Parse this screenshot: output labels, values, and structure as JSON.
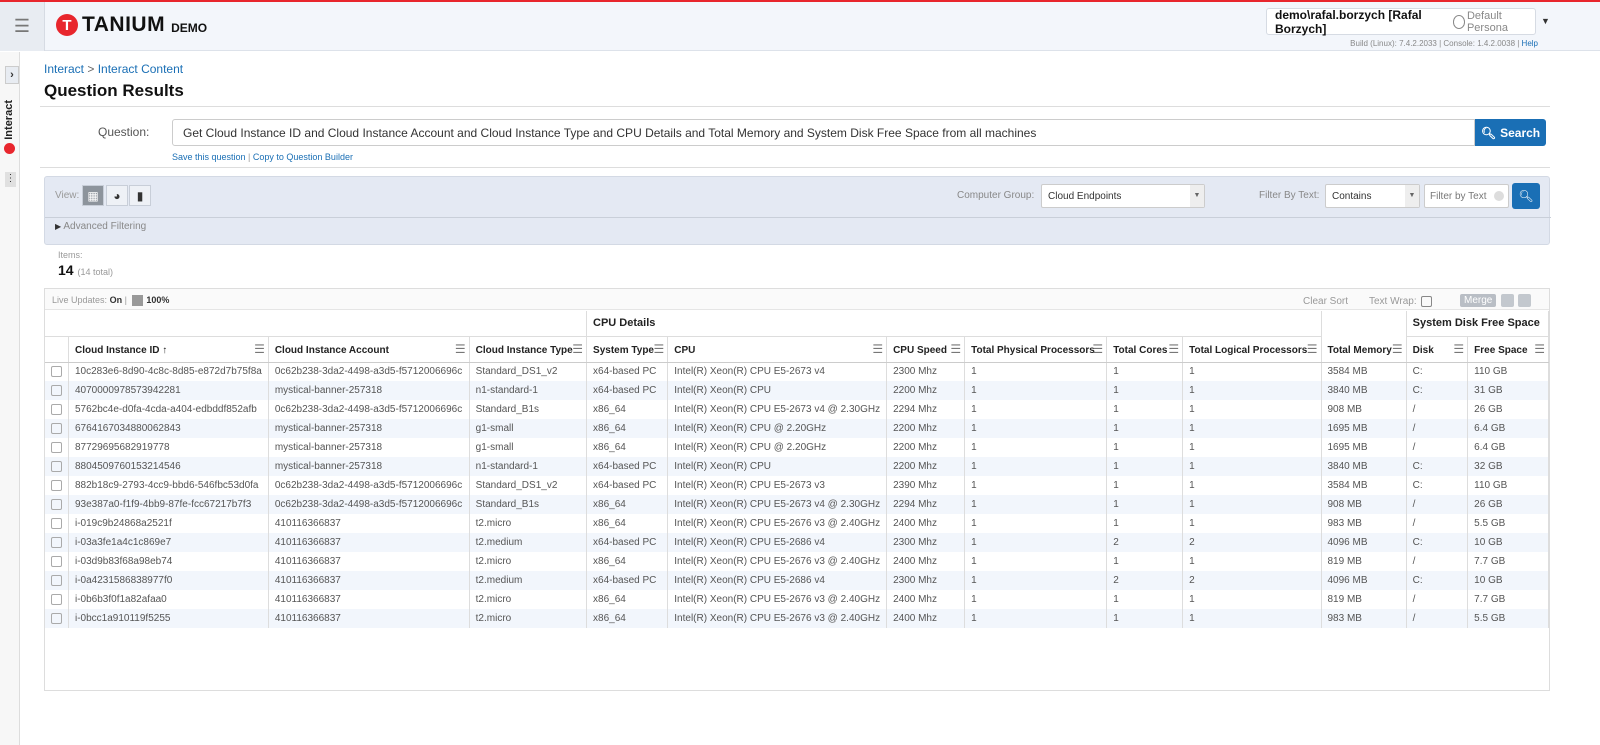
{
  "header": {
    "brand": "TANIUM",
    "brand_suffix": "DEMO",
    "user": "demo\\rafal.borzych [Rafal Borzych]",
    "persona": "Default Persona",
    "build": "Build (Linux): 7.4.2.2033 | Console: 1.4.2.0038 | ",
    "help": "Help"
  },
  "sidebar": {
    "label": "Interact"
  },
  "breadcrumb": {
    "root": "Interact",
    "sep": " > ",
    "current": "Interact Content"
  },
  "page_title": "Question Results",
  "question": {
    "label": "Question:",
    "value": "Get Cloud Instance ID and Cloud Instance Account and Cloud Instance Type and CPU Details and Total Memory and System Disk Free Space from all machines",
    "search": "Search",
    "save": "Save this question",
    "copy": "Copy to Question Builder"
  },
  "filters": {
    "view_label": "View:",
    "advanced": "Advanced Filtering",
    "computer_group_label": "Computer Group:",
    "computer_group": "Cloud Endpoints",
    "filter_label": "Filter By Text:",
    "filter_mode": "Contains",
    "filter_placeholder": "Filter by Text"
  },
  "items": {
    "label": "Items:",
    "count": "14",
    "total": "(14 total)"
  },
  "grid_toolbar": {
    "live_label": "Live Updates:",
    "live_value": "On",
    "progress": "100%",
    "clear_sort": "Clear Sort",
    "text_wrap": "Text Wrap:",
    "merge": "Merge"
  },
  "groups": {
    "cpu": "CPU Details",
    "disk": "System Disk Free Space"
  },
  "columns": [
    "Cloud Instance ID ↑",
    "Cloud Instance Account",
    "Cloud Instance Type",
    "System Type",
    "CPU",
    "CPU Speed",
    "Total Physical Processors",
    "Total Cores",
    "Total Logical Processors",
    "Total Memory",
    "Disk",
    "Free Space"
  ],
  "rows": [
    [
      "10c283e6-8d90-4c8c-8d85-e872d7b75f8a",
      "0c62b238-3da2-4498-a3d5-f5712006696c",
      "Standard_DS1_v2",
      "x64-based PC",
      "Intel(R) Xeon(R) CPU E5-2673 v4",
      "2300 Mhz",
      "1",
      "1",
      "1",
      "3584 MB",
      "C:",
      "110 GB"
    ],
    [
      "4070000978573942281",
      "mystical-banner-257318",
      "n1-standard-1",
      "x64-based PC",
      "Intel(R) Xeon(R) CPU",
      "2200 Mhz",
      "1",
      "1",
      "1",
      "3840 MB",
      "C:",
      "31 GB"
    ],
    [
      "5762bc4e-d0fa-4cda-a404-edbddf852afb",
      "0c62b238-3da2-4498-a3d5-f5712006696c",
      "Standard_B1s",
      "x86_64",
      "Intel(R) Xeon(R) CPU E5-2673 v4 @ 2.30GHz",
      "2294 Mhz",
      "1",
      "1",
      "1",
      "908 MB",
      "/",
      "26 GB"
    ],
    [
      "6764167034880062843",
      "mystical-banner-257318",
      "g1-small",
      "x86_64",
      "Intel(R) Xeon(R) CPU @ 2.20GHz",
      "2200 Mhz",
      "1",
      "1",
      "1",
      "1695 MB",
      "/",
      "6.4 GB"
    ],
    [
      "87729695682919778",
      "mystical-banner-257318",
      "g1-small",
      "x86_64",
      "Intel(R) Xeon(R) CPU @ 2.20GHz",
      "2200 Mhz",
      "1",
      "1",
      "1",
      "1695 MB",
      "/",
      "6.4 GB"
    ],
    [
      "8804509760153214546",
      "mystical-banner-257318",
      "n1-standard-1",
      "x64-based PC",
      "Intel(R) Xeon(R) CPU",
      "2200 Mhz",
      "1",
      "1",
      "1",
      "3840 MB",
      "C:",
      "32 GB"
    ],
    [
      "882b18c9-2793-4cc9-bbd6-546fbc53d0fa",
      "0c62b238-3da2-4498-a3d5-f5712006696c",
      "Standard_DS1_v2",
      "x64-based PC",
      "Intel(R) Xeon(R) CPU E5-2673 v3",
      "2390 Mhz",
      "1",
      "1",
      "1",
      "3584 MB",
      "C:",
      "110 GB"
    ],
    [
      "93e387a0-f1f9-4bb9-87fe-fcc67217b7f3",
      "0c62b238-3da2-4498-a3d5-f5712006696c",
      "Standard_B1s",
      "x86_64",
      "Intel(R) Xeon(R) CPU E5-2673 v4 @ 2.30GHz",
      "2294 Mhz",
      "1",
      "1",
      "1",
      "908 MB",
      "/",
      "26 GB"
    ],
    [
      "i-019c9b24868a2521f",
      "410116366837",
      "t2.micro",
      "x86_64",
      "Intel(R) Xeon(R) CPU E5-2676 v3 @ 2.40GHz",
      "2400 Mhz",
      "1",
      "1",
      "1",
      "983 MB",
      "/",
      "5.5 GB"
    ],
    [
      "i-03a3fe1a4c1c869e7",
      "410116366837",
      "t2.medium",
      "x64-based PC",
      "Intel(R) Xeon(R) CPU E5-2686 v4",
      "2300 Mhz",
      "1",
      "2",
      "2",
      "4096 MB",
      "C:",
      "10 GB"
    ],
    [
      "i-03d9b83f68a98eb74",
      "410116366837",
      "t2.micro",
      "x86_64",
      "Intel(R) Xeon(R) CPU E5-2676 v3 @ 2.40GHz",
      "2400 Mhz",
      "1",
      "1",
      "1",
      "819 MB",
      "/",
      "7.7 GB"
    ],
    [
      "i-0a4231586838977f0",
      "410116366837",
      "t2.medium",
      "x64-based PC",
      "Intel(R) Xeon(R) CPU E5-2686 v4",
      "2300 Mhz",
      "1",
      "2",
      "2",
      "4096 MB",
      "C:",
      "10 GB"
    ],
    [
      "i-0b6b3f0f1a82afaa0",
      "410116366837",
      "t2.micro",
      "x86_64",
      "Intel(R) Xeon(R) CPU E5-2676 v3 @ 2.40GHz",
      "2400 Mhz",
      "1",
      "1",
      "1",
      "819 MB",
      "/",
      "7.7 GB"
    ],
    [
      "i-0bcc1a910119f5255",
      "410116366837",
      "t2.micro",
      "x86_64",
      "Intel(R) Xeon(R) CPU E5-2676 v3 @ 2.40GHz",
      "2400 Mhz",
      "1",
      "1",
      "1",
      "983 MB",
      "/",
      "5.5 GB"
    ]
  ],
  "colors": {
    "brand": "#e8262d",
    "accent": "#1a6fb5",
    "panel": "#e4e9f3"
  }
}
